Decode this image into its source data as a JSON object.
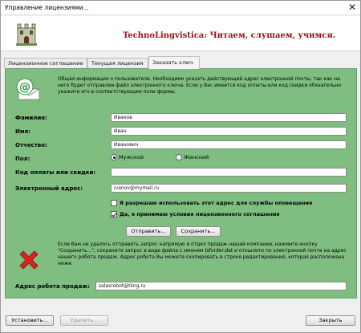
{
  "window": {
    "title": "Управление лицензиями...",
    "close_glyph": "✕"
  },
  "banner": {
    "heading": "TechnoLingvistica: Читаем, слушаем, учимся."
  },
  "tabs": [
    {
      "label": "Лицензионное соглашение",
      "active": false
    },
    {
      "label": "Текущая лицензия",
      "active": false
    },
    {
      "label": "Заказать ключ",
      "active": true
    }
  ],
  "info": {
    "text": "Общая информация о пользователе. Необходимо указать действующий адрес электронной почты, так как на него будет отправлен файл электронного ключа. Если у Вас имеется код оплаты или код скидки обязательно укажите его в соответствующем поле формы."
  },
  "form": {
    "surname_label": "Фамилия:",
    "surname_value": "Иванов",
    "name_label": "Имя:",
    "name_value": "Иван",
    "patronymic_label": "Отчество:",
    "patronymic_value": "Иванович",
    "gender_label": "Пол:",
    "gender_male": "Мужской",
    "gender_female": "Женский",
    "gender_selected": "Мужской",
    "code_label": "Код оплаты или скидки:",
    "code_value": "",
    "email_label": "Электронный адрес:",
    "email_value": "ivanov@mymail.ru",
    "notify_label": "Я разрешаю использовать этот адрес для службы оповещения",
    "notify_checked": false,
    "agree_label": "Да, я принимаю условия лицензионного соглашения",
    "agree_checked": true
  },
  "actions": {
    "send_label": "Отправить...",
    "save_label": "Сохранить..."
  },
  "warning": {
    "text": "Если Вам не удалось отправить запрос напрямую в отдел продаж нашей компании, нажмите кнопку \"Сохранить...\", сохраните запрос в виде файла с именем tsforder.dat и отошлите по электронной почте на адрес нашего робота продаж. Адрес робота Вы можете скопировать в строке редактирования, которая расположена ниже."
  },
  "robot": {
    "label": "Адрес робота продаж:",
    "value": "salesrobot@tling.ru"
  },
  "footer": {
    "install_label": "Установить...",
    "delete_label": "Удалить...",
    "close_label": "Закрыть"
  },
  "colors": {
    "panel_bg": "#7fbd80",
    "heading": "#9c1010"
  }
}
